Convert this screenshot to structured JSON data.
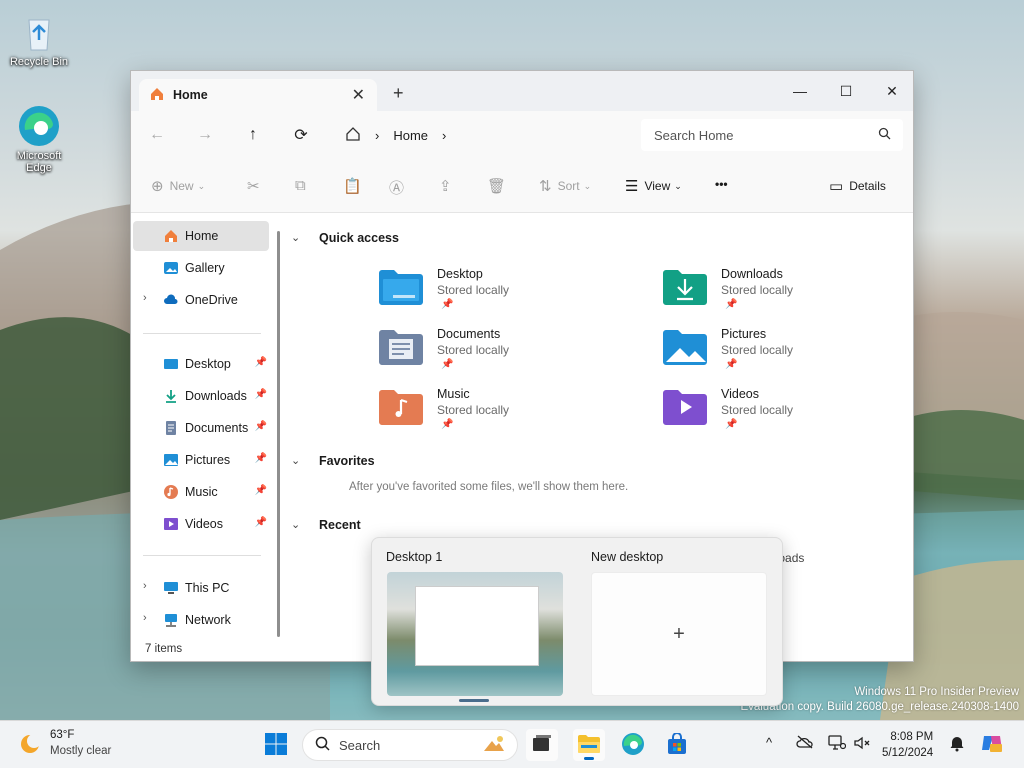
{
  "desktop": {
    "icons": [
      {
        "label": "Recycle Bin"
      },
      {
        "label": "Microsoft Edge"
      }
    ],
    "watermark": {
      "line1": "Windows 11 Pro Insider Preview",
      "line2": "Evaluation copy. Build 26080.ge_release.240308-1400"
    }
  },
  "window": {
    "tab_title": "Home",
    "tab_close": "✕",
    "new_tab": "+",
    "controls": {
      "minimize": "—",
      "maximize": "☐",
      "close": "✕"
    },
    "nav": {
      "back": "←",
      "forward": "→",
      "up": "↑",
      "refresh": "⟳"
    },
    "breadcrumb": {
      "location": "Home",
      "sep": "›"
    },
    "search_placeholder": "Search Home",
    "commands": {
      "new": "New",
      "sort": "Sort",
      "view": "View",
      "more": "•••",
      "details": "Details"
    },
    "sidebar": {
      "top": [
        {
          "label": "Home"
        },
        {
          "label": "Gallery"
        },
        {
          "label": "OneDrive"
        }
      ],
      "pinned": [
        {
          "label": "Desktop"
        },
        {
          "label": "Downloads"
        },
        {
          "label": "Documents"
        },
        {
          "label": "Pictures"
        },
        {
          "label": "Music"
        },
        {
          "label": "Videos"
        }
      ],
      "bottom": [
        {
          "label": "This PC"
        },
        {
          "label": "Network"
        }
      ]
    },
    "sections": {
      "quick_access": "Quick access",
      "favorites": "Favorites",
      "favorites_hint": "After you've favorited some files, we'll show them here.",
      "recent": "Recent"
    },
    "quick_access": [
      {
        "name": "Desktop",
        "status": "Stored locally"
      },
      {
        "name": "Downloads",
        "status": "Stored locally"
      },
      {
        "name": "Documents",
        "status": "Stored locally"
      },
      {
        "name": "Pictures",
        "status": "Stored locally"
      },
      {
        "name": "Music",
        "status": "Stored locally"
      },
      {
        "name": "Videos",
        "status": "Stored locally"
      }
    ],
    "status_bar": "7 items",
    "recent_partial": "nloads"
  },
  "task_view": {
    "desktops": [
      {
        "label": "Desktop 1"
      },
      {
        "label": "New desktop",
        "add_glyph": "+"
      }
    ]
  },
  "taskbar": {
    "weather": {
      "temp": "63°F",
      "condition": "Mostly clear"
    },
    "search_label": "Search",
    "clock": {
      "time": "8:08 PM",
      "date": "5/12/2024"
    },
    "tray_chevron": "^"
  },
  "colors": {
    "accent": "#0067c0",
    "folder_blue": "#1f8fd6",
    "folder_green": "#12a085",
    "folder_gray": "#6f83a3",
    "folder_orange": "#e47b52",
    "folder_purple": "#7e4fcf"
  }
}
